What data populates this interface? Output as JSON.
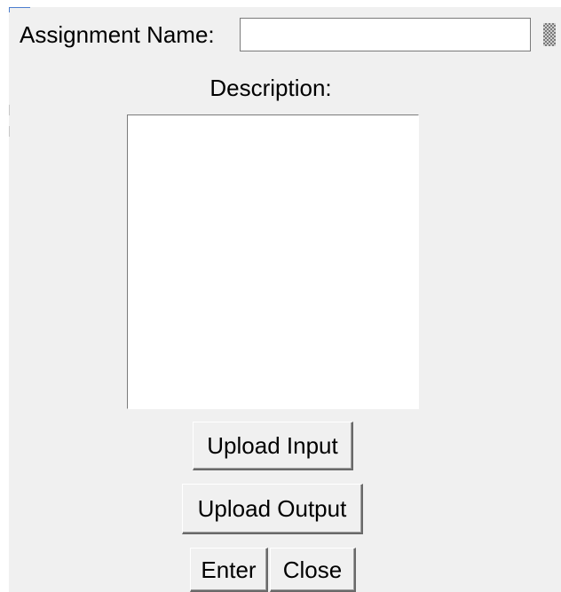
{
  "form": {
    "assignment_name_label": "Assignment Name:",
    "assignment_name_value": "",
    "description_label": "Description:",
    "description_value": ""
  },
  "buttons": {
    "upload_input": "Upload Input",
    "upload_output": "Upload Output",
    "enter": "Enter",
    "close": "Close"
  },
  "icons": {
    "resize_grip": "resize-grip-icon"
  },
  "colors": {
    "window_background": "#f0f0f0",
    "field_background": "#ffffff",
    "focus_accent": "#4c7ecf"
  }
}
